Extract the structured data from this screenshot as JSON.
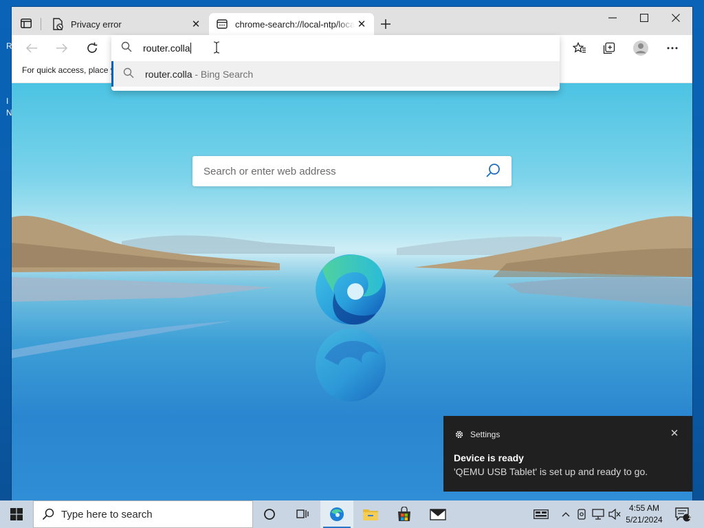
{
  "desktop": {
    "glyphs": [
      "R",
      "I",
      "N"
    ]
  },
  "browser": {
    "tabs": [
      {
        "title": "Privacy error",
        "active": false
      },
      {
        "title": "chrome-search://local-ntp/local-ntp.html",
        "active": true
      }
    ],
    "toolbar": {
      "address_value": "router.colla"
    },
    "favorites_bar_text": "For quick access, place y",
    "omnibox": {
      "query": "router.colla",
      "suggestion_query": "router.colla",
      "suggestion_suffix": " - Bing Search"
    },
    "ntp": {
      "search_placeholder": "Search or enter web address"
    }
  },
  "notification": {
    "app_name": "Settings",
    "title": "Device is ready",
    "body": "'QEMU USB Tablet' is set up and ready to go."
  },
  "taskbar": {
    "search_placeholder": "Type here to search",
    "clock_time": "4:55 AM",
    "clock_date": "5/21/2024",
    "notification_count": "1"
  },
  "colors": {
    "accent": "#0a64b6",
    "taskbar": "#c9d5e2",
    "toast_bg": "#202020"
  }
}
